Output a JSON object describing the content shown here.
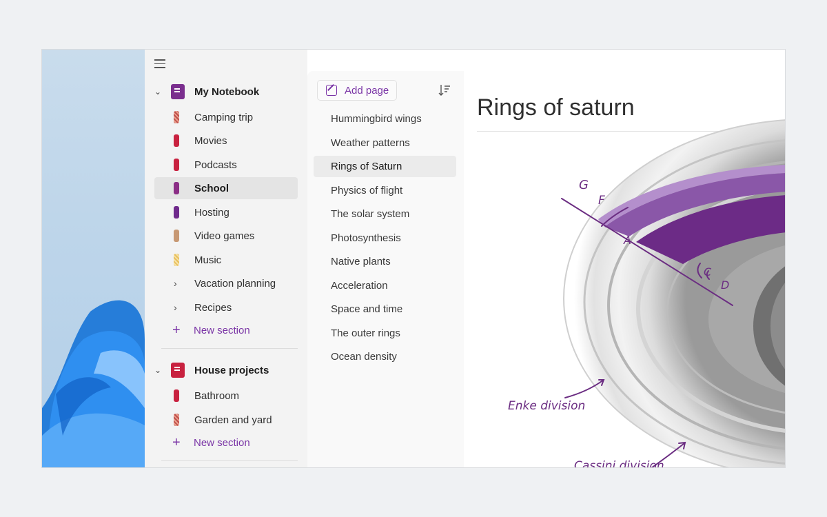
{
  "sidebar": {
    "notebooks": [
      {
        "name": "My Notebook",
        "color": "#7a2e8e",
        "sections": [
          {
            "label": "Camping trip",
            "color": "#c0504d",
            "pattern": true
          },
          {
            "label": "Movies",
            "color": "#c8213f"
          },
          {
            "label": "Podcasts",
            "color": "#c8213f"
          },
          {
            "label": "School",
            "color": "#8b2e86",
            "selected": true
          },
          {
            "label": "Hosting",
            "color": "#6f2a8c"
          },
          {
            "label": "Video games",
            "color": "#c79873"
          },
          {
            "label": "Music",
            "color": "#e8c060",
            "pattern": true
          },
          {
            "label": "Vacation planning",
            "group": true
          },
          {
            "label": "Recipes",
            "group": true
          }
        ],
        "new_section": "New section"
      },
      {
        "name": "House projects",
        "color": "#c8213f",
        "sections": [
          {
            "label": "Bathroom",
            "color": "#c8213f"
          },
          {
            "label": "Garden and yard",
            "color": "#c0504d",
            "pattern": true
          }
        ],
        "new_section": "New section"
      }
    ]
  },
  "pagelist": {
    "add_page": "Add page",
    "pages": [
      {
        "label": "Hummingbird wings"
      },
      {
        "label": "Weather patterns"
      },
      {
        "label": "Rings of Saturn",
        "selected": true
      },
      {
        "label": "Physics of flight"
      },
      {
        "label": "The solar system"
      },
      {
        "label": "Photosynthesis"
      },
      {
        "label": "Native plants"
      },
      {
        "label": "Acceleration"
      },
      {
        "label": "Space and time"
      },
      {
        "label": "The outer rings"
      },
      {
        "label": "Ocean density"
      }
    ]
  },
  "canvas": {
    "title": "Rings of saturn",
    "annotations": {
      "g": "G",
      "f": "F",
      "a": "A",
      "c": "C",
      "d": "D",
      "enke": "Enke division",
      "cassini": "Cassini division"
    },
    "ink_color": "#6b2d82"
  }
}
